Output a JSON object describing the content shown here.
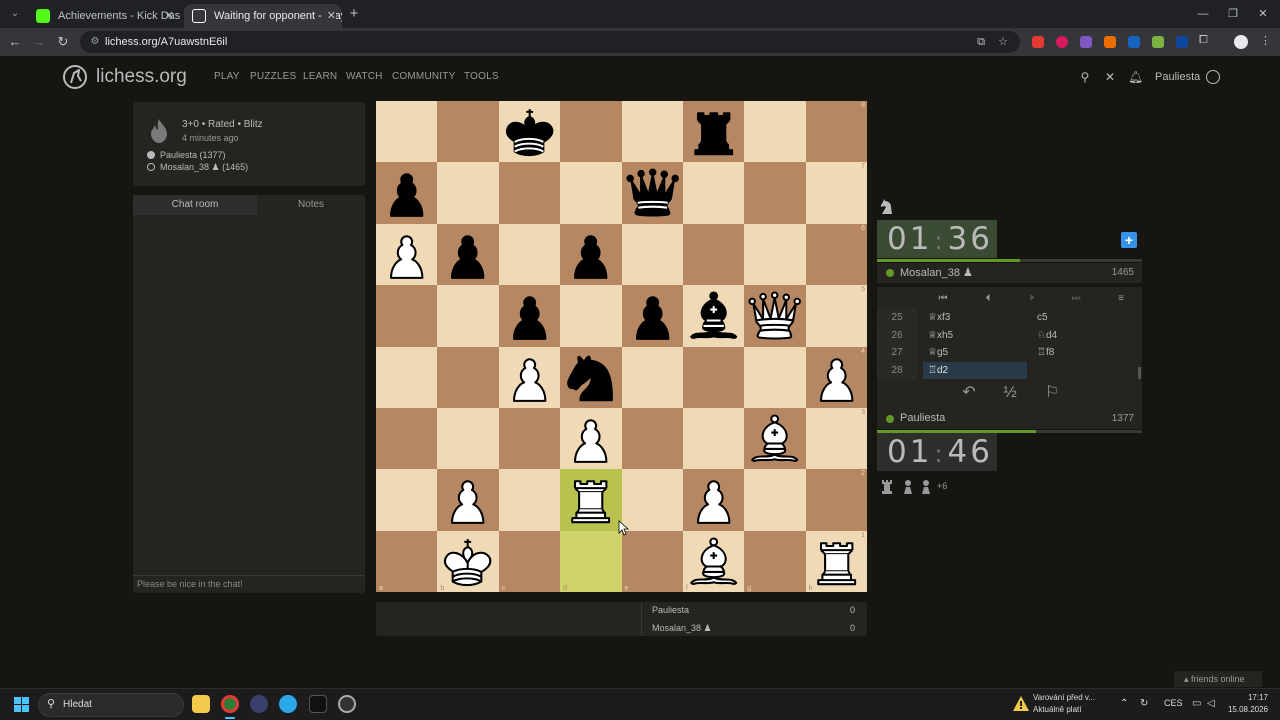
{
  "browser": {
    "tabs": [
      {
        "title": "Achievements - Kick Dashboard",
        "favicon_color": "#53fc18"
      },
      {
        "title": "Waiting for opponent - Play M",
        "favicon_color": "#ffffff"
      }
    ],
    "url": "lichess.org/A7uawstnE6il"
  },
  "site": {
    "brand": "lichess.org",
    "nav": [
      "PLAY",
      "PUZZLES",
      "LEARN",
      "WATCH",
      "COMMUNITY",
      "TOOLS"
    ],
    "username": "Pauliesta"
  },
  "game_info": {
    "type": "3+0 • Rated • Blitz",
    "time_ago": "4 minutes ago",
    "white_player": "Pauliesta (1377)",
    "black_player": "Mosalan_38 ♟ (1465)"
  },
  "chat": {
    "tabs": [
      "Chat room",
      "Notes"
    ],
    "placeholder": "Please be nice in the chat!"
  },
  "board": {
    "ranks": [
      "8",
      "7",
      "6",
      "5",
      "4",
      "3",
      "2",
      "1"
    ],
    "files": [
      "a",
      "b",
      "c",
      "d",
      "e",
      "f",
      "g",
      "h"
    ],
    "position": [
      [
        "",
        "",
        "bK",
        "",
        "",
        "bR",
        "",
        ""
      ],
      [
        "bP",
        "",
        "",
        "",
        "bQ",
        "",
        "",
        ""
      ],
      [
        "wP",
        "bP",
        "",
        "bP",
        "",
        "",
        "",
        ""
      ],
      [
        "",
        "",
        "bP",
        "",
        "bP",
        "bB",
        "wQ",
        ""
      ],
      [
        "",
        "",
        "wP",
        "bN",
        "",
        "",
        "",
        "wP"
      ],
      [
        "",
        "",
        "",
        "wP",
        "",
        "",
        "wB",
        ""
      ],
      [
        "",
        "wP",
        "",
        "wR",
        "",
        "wP",
        "",
        ""
      ],
      [
        "",
        "wK",
        "",
        "",
        "",
        "wB",
        "",
        "wR"
      ]
    ],
    "last_move": [
      "d2",
      "d1"
    ]
  },
  "crosstable": [
    {
      "name": "Pauliesta",
      "score": "0"
    },
    {
      "name": "Mosalan_38 ♟",
      "score": "0"
    }
  ],
  "opponent": {
    "clock_min": "01",
    "clock_sec": "36",
    "name": "Mosalan_38 ♟",
    "rating": "1465",
    "time_fraction": 0.54
  },
  "player": {
    "clock_min": "01",
    "clock_sec": "46",
    "name": "Pauliesta",
    "rating": "1377",
    "time_fraction": 0.6,
    "material_diff": "+6"
  },
  "moves": [
    {
      "num": "25",
      "white": "♕xf3",
      "black": "c5"
    },
    {
      "num": "26",
      "white": "♕xh5",
      "black": "♘d4"
    },
    {
      "num": "27",
      "white": "♕g5",
      "black": "♖f8"
    },
    {
      "num": "28",
      "white": "♖d2",
      "black": ""
    }
  ],
  "controls": {
    "first": "⏮",
    "prev": "⏴",
    "next": "⏵",
    "last": "⏭",
    "menu": "≡",
    "takeback": "↶",
    "draw": "½",
    "resign": "⚐"
  },
  "friends": "friends online",
  "taskbar": {
    "search": "Hledat",
    "warn_line1": "Varování před v...",
    "warn_line2": "Aktuálně platí",
    "lang": "CES",
    "time": "17:17",
    "date": "15.08.2026"
  },
  "colors": {
    "light_square": "#f0d9b5",
    "dark_square": "#b58863",
    "accent_green": "#629924",
    "accent_blue": "#3692e7"
  }
}
